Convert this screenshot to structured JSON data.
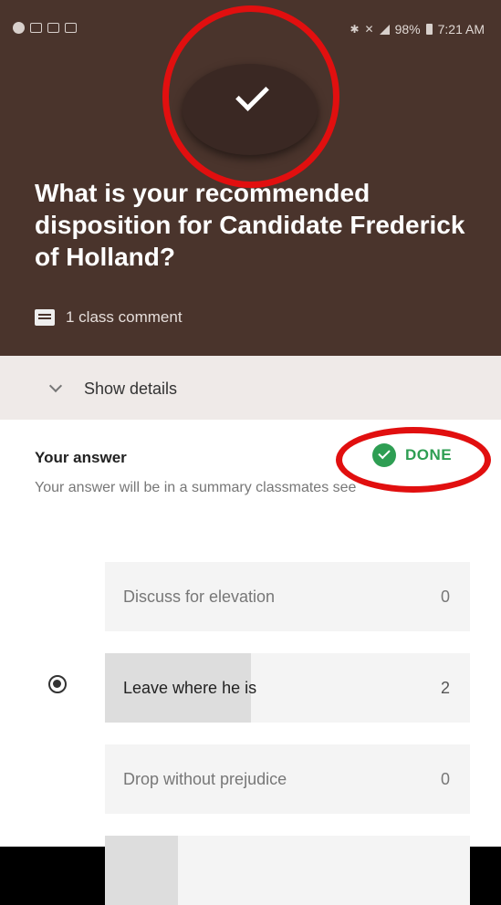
{
  "status_bar": {
    "battery": "98%",
    "time": "7:21 AM"
  },
  "question": {
    "text": "What is your recommended disposition for Candidate Frederick of Holland?",
    "comments": "1 class comment"
  },
  "details": {
    "label": "Show details"
  },
  "answer": {
    "title": "Your answer",
    "subtitle": "Your answer will be in a summary classmates see",
    "status": "DONE"
  },
  "options": [
    {
      "label": "Discuss for elevation",
      "count": "0",
      "share": 0,
      "selected": false
    },
    {
      "label": "Leave where he is",
      "count": "2",
      "share": 0.4,
      "selected": true
    },
    {
      "label": "Drop without prejudice",
      "count": "0",
      "share": 0,
      "selected": false
    },
    {
      "label": "",
      "count": "",
      "share": 0.2,
      "selected": false
    }
  ],
  "colors": {
    "header": "#4a342c",
    "done": "#2e9e53",
    "highlight_ring": "#e10f0f"
  }
}
